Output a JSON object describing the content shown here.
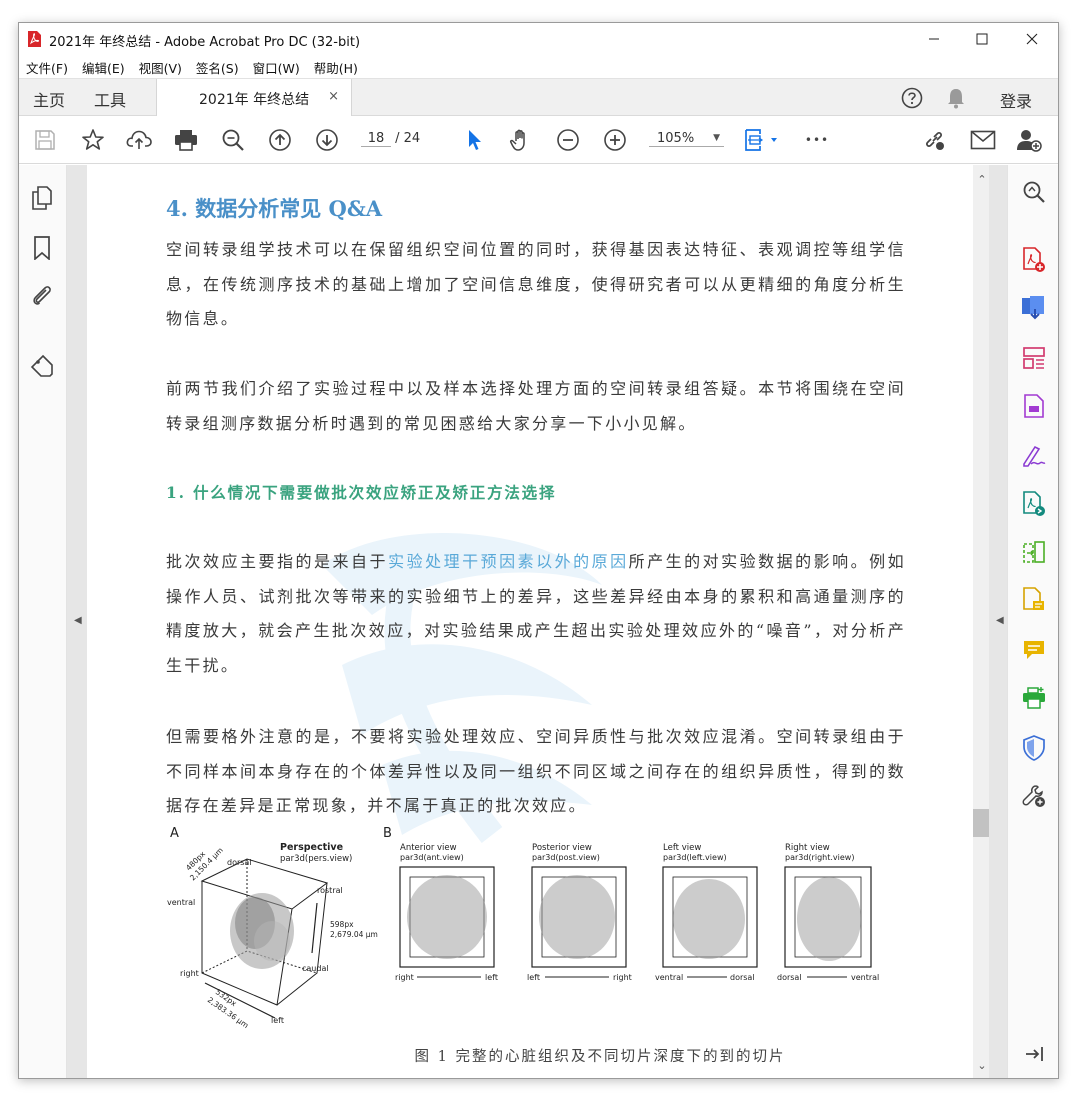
{
  "window": {
    "title": "2021年 年终总结 - Adobe Acrobat Pro DC (32-bit)",
    "minimize_glyph": "—",
    "maximize_glyph": "☐",
    "close_glyph": "✕"
  },
  "menu": [
    "文件(F)",
    "编辑(E)",
    "视图(V)",
    "签名(S)",
    "窗口(W)",
    "帮助(H)"
  ],
  "tabs": {
    "home": "主页",
    "tools": "工具",
    "document": "2021年 年终总结",
    "close": "×",
    "login": "登录"
  },
  "toolbar": {
    "current_page": "18",
    "total_pages": "/ 24",
    "zoom": "105%",
    "more": "•••"
  },
  "document": {
    "heading": "4. 数据分析常见 Q&A",
    "p1": "空间转录组学技术可以在保留组织空间位置的同时，获得基因表达特征、表观调控等组学信息，在传统测序技术的基础上增加了空间信息维度，使得研究者可以从更精细的角度分析生物信息。",
    "p2": "前两节我们介绍了实验过程中以及样本选择处理方面的空间转录组答疑。本节将围绕在空间转录组测序数据分析时遇到的常见困惑给大家分享一下小小见解。",
    "subheading": "1. 什么情况下需要做批次效应矫正及矫正方法选择",
    "p3_before": "批次效应主要指的是来自于",
    "p3_highlight": "实验处理干预因素以外的原因",
    "p3_after": "所产生的对实验数据的影响。例如操作人员、试剂批次等带来的实验细节上的差异，这些差异经由本身的累积和高通量测序的精度放大，就会产生批次效应，对实验结果成产生超出实验处理效应外的“噪音”，对分析产生干扰。",
    "p4": "但需要格外注意的是，不要将实验处理效应、空间异质性与批次效应混淆。空间转录组由于不同样本间本身存在的个体差异性以及同一组织不同区域之间存在的组织异质性，得到的数据存在差异是正常现象，并不属于真正的批次效应。",
    "caption": "图 1  完整的心脏组织及不同切片深度下的到的切片"
  },
  "figure": {
    "panel_a": "A",
    "panel_b": "B",
    "perspective_title": "Perspective",
    "perspective_code": "par3d(pers.view)",
    "dorsal": "dorsal",
    "ventral": "ventral",
    "rostral": "rostral",
    "caudal": "caudal",
    "right": "right",
    "left": "left",
    "dim1a": "480px",
    "dim1b": "2,150.4 μm",
    "dim2a": "598px",
    "dim2b": "2,679.04 μm",
    "dim3a": "532px",
    "dim3b": "2,383.36 μm",
    "views": [
      {
        "title": "Anterior view",
        "code": "par3d(ant.view)",
        "l": "right",
        "r": "left"
      },
      {
        "title": "Posterior view",
        "code": "par3d(post.view)",
        "l": "left",
        "r": "right"
      },
      {
        "title": "Left view",
        "code": "par3d(left.view)",
        "l": "ventral",
        "r": "dorsal"
      },
      {
        "title": "Right view",
        "code": "par3d(right.view)",
        "l": "dorsal",
        "r": "ventral"
      }
    ]
  },
  "colors": {
    "heading": "#4a90c8",
    "subheading": "#3aa37f",
    "highlight": "#5aa9d8",
    "acrobat_red": "#d8262a"
  }
}
